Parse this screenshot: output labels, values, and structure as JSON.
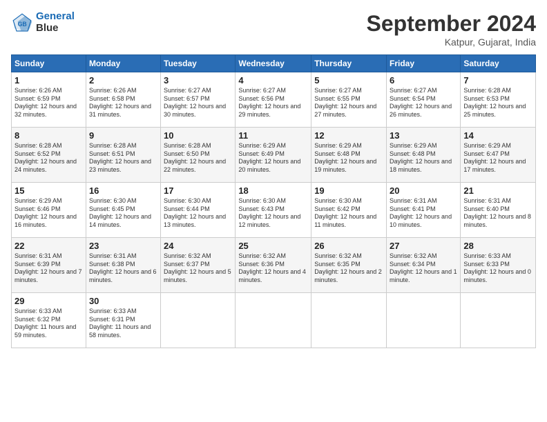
{
  "logo": {
    "text1": "General",
    "text2": "Blue"
  },
  "title": "September 2024",
  "location": "Katpur, Gujarat, India",
  "headers": [
    "Sunday",
    "Monday",
    "Tuesday",
    "Wednesday",
    "Thursday",
    "Friday",
    "Saturday"
  ],
  "weeks": [
    [
      {
        "day": "1",
        "sunrise": "6:26 AM",
        "sunset": "6:59 PM",
        "daylight": "12 hours and 32 minutes."
      },
      {
        "day": "2",
        "sunrise": "6:26 AM",
        "sunset": "6:58 PM",
        "daylight": "12 hours and 31 minutes."
      },
      {
        "day": "3",
        "sunrise": "6:27 AM",
        "sunset": "6:57 PM",
        "daylight": "12 hours and 30 minutes."
      },
      {
        "day": "4",
        "sunrise": "6:27 AM",
        "sunset": "6:56 PM",
        "daylight": "12 hours and 29 minutes."
      },
      {
        "day": "5",
        "sunrise": "6:27 AM",
        "sunset": "6:55 PM",
        "daylight": "12 hours and 27 minutes."
      },
      {
        "day": "6",
        "sunrise": "6:27 AM",
        "sunset": "6:54 PM",
        "daylight": "12 hours and 26 minutes."
      },
      {
        "day": "7",
        "sunrise": "6:28 AM",
        "sunset": "6:53 PM",
        "daylight": "12 hours and 25 minutes."
      }
    ],
    [
      {
        "day": "8",
        "sunrise": "6:28 AM",
        "sunset": "6:52 PM",
        "daylight": "12 hours and 24 minutes."
      },
      {
        "day": "9",
        "sunrise": "6:28 AM",
        "sunset": "6:51 PM",
        "daylight": "12 hours and 23 minutes."
      },
      {
        "day": "10",
        "sunrise": "6:28 AM",
        "sunset": "6:50 PM",
        "daylight": "12 hours and 22 minutes."
      },
      {
        "day": "11",
        "sunrise": "6:29 AM",
        "sunset": "6:49 PM",
        "daylight": "12 hours and 20 minutes."
      },
      {
        "day": "12",
        "sunrise": "6:29 AM",
        "sunset": "6:48 PM",
        "daylight": "12 hours and 19 minutes."
      },
      {
        "day": "13",
        "sunrise": "6:29 AM",
        "sunset": "6:48 PM",
        "daylight": "12 hours and 18 minutes."
      },
      {
        "day": "14",
        "sunrise": "6:29 AM",
        "sunset": "6:47 PM",
        "daylight": "12 hours and 17 minutes."
      }
    ],
    [
      {
        "day": "15",
        "sunrise": "6:29 AM",
        "sunset": "6:46 PM",
        "daylight": "12 hours and 16 minutes."
      },
      {
        "day": "16",
        "sunrise": "6:30 AM",
        "sunset": "6:45 PM",
        "daylight": "12 hours and 14 minutes."
      },
      {
        "day": "17",
        "sunrise": "6:30 AM",
        "sunset": "6:44 PM",
        "daylight": "12 hours and 13 minutes."
      },
      {
        "day": "18",
        "sunrise": "6:30 AM",
        "sunset": "6:43 PM",
        "daylight": "12 hours and 12 minutes."
      },
      {
        "day": "19",
        "sunrise": "6:30 AM",
        "sunset": "6:42 PM",
        "daylight": "12 hours and 11 minutes."
      },
      {
        "day": "20",
        "sunrise": "6:31 AM",
        "sunset": "6:41 PM",
        "daylight": "12 hours and 10 minutes."
      },
      {
        "day": "21",
        "sunrise": "6:31 AM",
        "sunset": "6:40 PM",
        "daylight": "12 hours and 8 minutes."
      }
    ],
    [
      {
        "day": "22",
        "sunrise": "6:31 AM",
        "sunset": "6:39 PM",
        "daylight": "12 hours and 7 minutes."
      },
      {
        "day": "23",
        "sunrise": "6:31 AM",
        "sunset": "6:38 PM",
        "daylight": "12 hours and 6 minutes."
      },
      {
        "day": "24",
        "sunrise": "6:32 AM",
        "sunset": "6:37 PM",
        "daylight": "12 hours and 5 minutes."
      },
      {
        "day": "25",
        "sunrise": "6:32 AM",
        "sunset": "6:36 PM",
        "daylight": "12 hours and 4 minutes."
      },
      {
        "day": "26",
        "sunrise": "6:32 AM",
        "sunset": "6:35 PM",
        "daylight": "12 hours and 2 minutes."
      },
      {
        "day": "27",
        "sunrise": "6:32 AM",
        "sunset": "6:34 PM",
        "daylight": "12 hours and 1 minute."
      },
      {
        "day": "28",
        "sunrise": "6:33 AM",
        "sunset": "6:33 PM",
        "daylight": "12 hours and 0 minutes."
      }
    ],
    [
      {
        "day": "29",
        "sunrise": "6:33 AM",
        "sunset": "6:32 PM",
        "daylight": "11 hours and 59 minutes."
      },
      {
        "day": "30",
        "sunrise": "6:33 AM",
        "sunset": "6:31 PM",
        "daylight": "11 hours and 58 minutes."
      },
      null,
      null,
      null,
      null,
      null
    ]
  ]
}
